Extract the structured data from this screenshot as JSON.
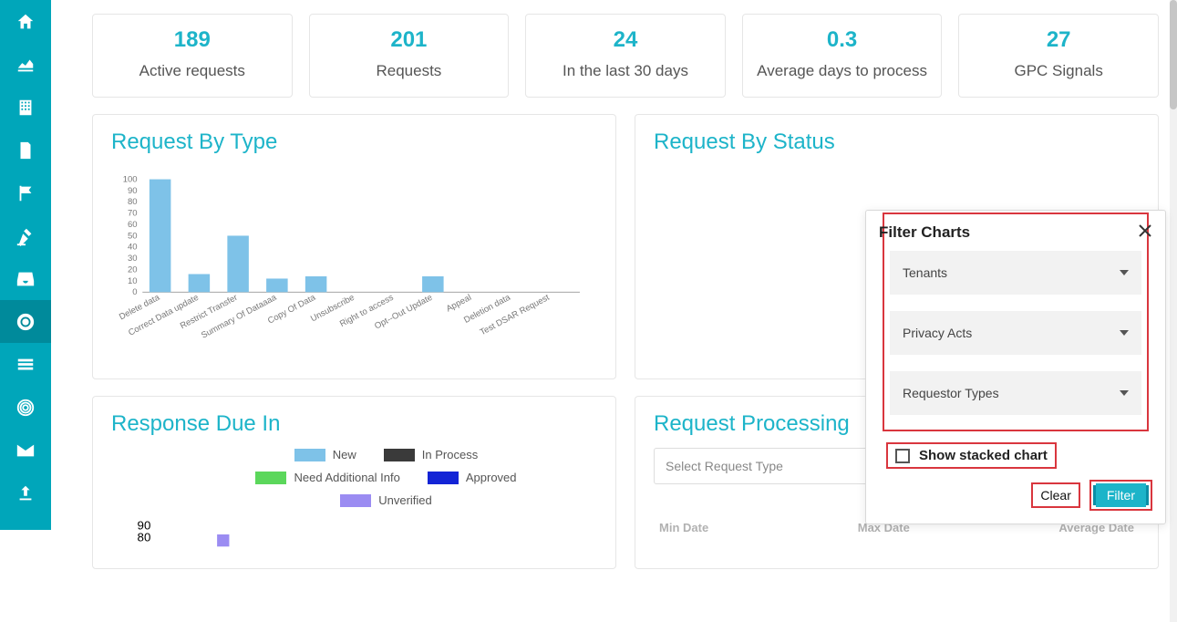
{
  "sidebar": {},
  "kpis": [
    {
      "value": "189",
      "label": "Active requests"
    },
    {
      "value": "201",
      "label": "Requests"
    },
    {
      "value": "24",
      "label": "In the last 30 days"
    },
    {
      "value": "0.3",
      "label": "Average days to process"
    },
    {
      "value": "27",
      "label": "GPC Signals"
    }
  ],
  "cards": {
    "byType": {
      "title": "Request By Type"
    },
    "byStatus": {
      "title": "Request By Status"
    },
    "responseDue": {
      "title": "Response Due In"
    },
    "processing": {
      "title": "Request Processing"
    }
  },
  "processing": {
    "select_placeholder": "Select Request Type",
    "table_headers": [
      "Min Date",
      "Max Date",
      "Average Date"
    ]
  },
  "legend": [
    {
      "label": "New",
      "color": "#7ec2e8"
    },
    {
      "label": "In Process",
      "color": "#3a3a3a"
    },
    {
      "label": "Need Additional Info",
      "color": "#5bd75b"
    },
    {
      "label": "Approved",
      "color": "#1324d6"
    },
    {
      "label": "Unverified",
      "color": "#9b8cf2"
    }
  ],
  "responseDueAxis": {
    "tick1": "90",
    "tick2": "80"
  },
  "filter": {
    "title": "Filter Charts",
    "drops": [
      "Tenants",
      "Privacy Acts",
      "Requestor Types"
    ],
    "stacked_label": "Show stacked chart",
    "clear": "Clear",
    "apply": "Filter"
  },
  "chart_data": {
    "type": "bar",
    "title": "Request By Type",
    "xlabel": "",
    "ylabel": "",
    "ylim": [
      0,
      100
    ],
    "yticks": [
      0,
      10,
      20,
      30,
      40,
      50,
      60,
      70,
      80,
      90,
      100
    ],
    "categories": [
      "Delete data",
      "Correct Data update",
      "Restrict Transfer",
      "Summary Of Dataaaa",
      "Copy Of Data",
      "Unsubscribe",
      "Right to access",
      "Opt--Out Update",
      "Appeal",
      "Deletion data",
      "Test DSAR Request"
    ],
    "values": [
      100,
      16,
      50,
      12,
      14,
      0,
      0,
      14,
      0,
      0,
      0
    ]
  }
}
